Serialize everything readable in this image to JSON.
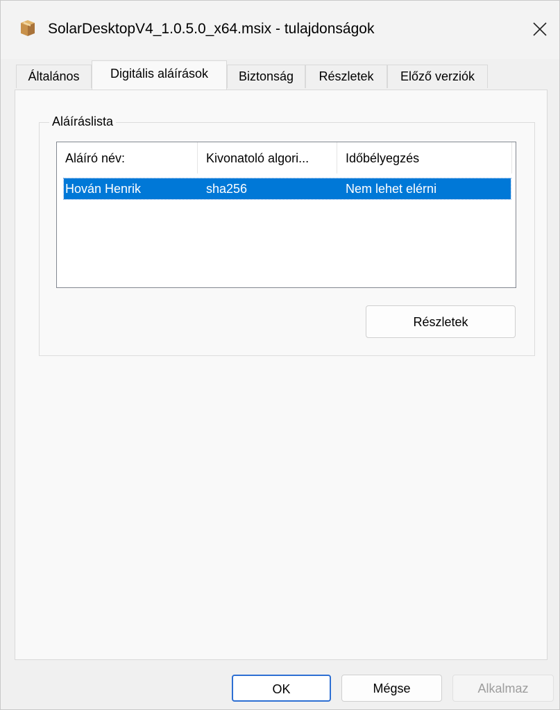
{
  "window": {
    "title": "SolarDesktopV4_1.0.5.0_x64.msix - tulajdonságok",
    "app_icon": "package-box-icon",
    "close_icon": "close-icon"
  },
  "tabs": [
    {
      "label": "Általános",
      "active": false
    },
    {
      "label": "Digitális aláírások",
      "active": true
    },
    {
      "label": "Biztonság",
      "active": false
    },
    {
      "label": "Részletek",
      "active": false
    },
    {
      "label": "Előző verziók",
      "active": false
    }
  ],
  "signatures": {
    "group_label": "Aláíráslista",
    "columns": [
      "Aláíró név:",
      "Kivonatoló algori...",
      "Időbélyegzés"
    ],
    "rows": [
      {
        "signer": "Hován Henrik",
        "algorithm": "sha256",
        "timestamp": "Nem lehet elérni",
        "selected": true
      }
    ],
    "details_button": "Részletek"
  },
  "footer": {
    "ok": "OK",
    "cancel": "Mégse",
    "apply": "Alkalmaz"
  },
  "colors": {
    "selection": "#0078d7",
    "ok_border": "#2d6fd3",
    "disabled_text": "#9d9d9d"
  }
}
